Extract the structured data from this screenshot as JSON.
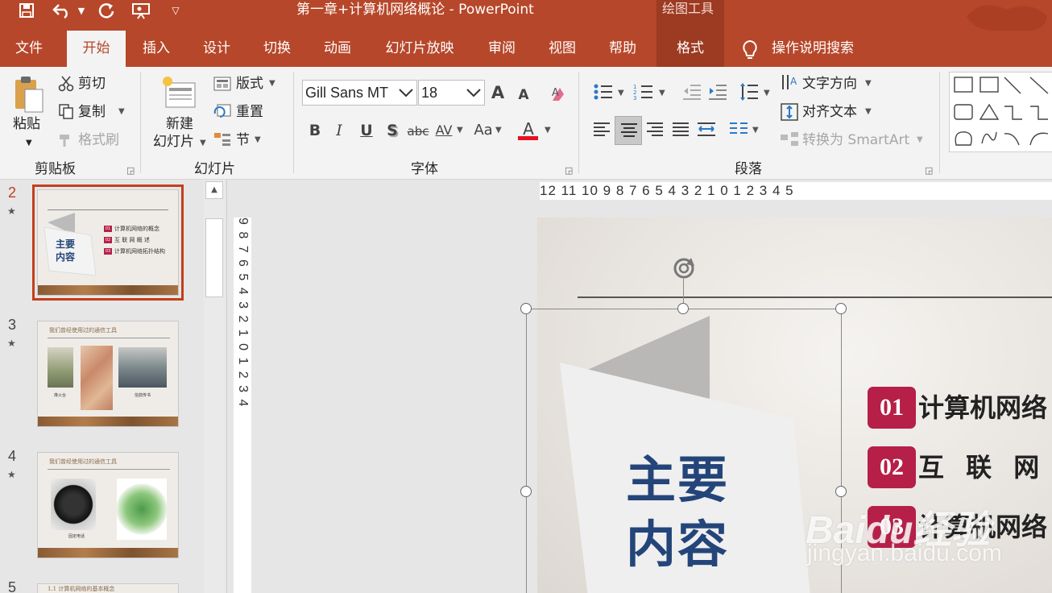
{
  "window": {
    "title": "第一章+计算机网络概论  -  PowerPoint",
    "context_tool_tab": "绘图工具"
  },
  "qat": {
    "icons": [
      "save-icon",
      "undo-icon",
      "undo-dropdown-icon",
      "redo-icon",
      "slideshow-from-start-icon",
      "customize-qat-icon"
    ]
  },
  "tabs": [
    "文件",
    "开始",
    "插入",
    "设计",
    "切换",
    "动画",
    "幻灯片放映",
    "审阅",
    "视图",
    "帮助",
    "格式"
  ],
  "active_tab": "开始",
  "tell_me": "操作说明搜索",
  "clipboard": {
    "paste": "粘贴",
    "cut": "剪切",
    "copy": "复制",
    "format_painter": "格式刷",
    "label": "剪贴板"
  },
  "slides_group": {
    "new_slide_line1": "新建",
    "new_slide_line2": "幻灯片",
    "layout": "版式",
    "reset": "重置",
    "section": "节",
    "label": "幻灯片"
  },
  "font": {
    "name": "Gill Sans MT",
    "size": "18",
    "increase": "A",
    "decrease": "A",
    "bold": "B",
    "italic": "I",
    "underline": "U",
    "shadow": "S",
    "strike": "abc",
    "spacing": "AV",
    "case": "Aa",
    "color_letter": "A",
    "color": "#e81123",
    "label": "字体"
  },
  "paragraph": {
    "label": "段落"
  },
  "text_tools": {
    "direction": "文字方向",
    "align_text": "对齐文本",
    "smartart": "转换为 SmartArt"
  },
  "ruler": {
    "horizontal": "12 11 10 9 8 7 6 5 4 3 2 1 0 1 2 3 4 5",
    "vertical": "9 8 7 6 5 4 3 2 1 0 1 2 3 4"
  },
  "thumbnails": [
    {
      "num": "2",
      "title_line1": "主要",
      "title_line2": "内容",
      "items": [
        "计算机网络的概念",
        "互 联 网 概 述",
        "计算机网络拓扑结构"
      ],
      "badges": [
        "01",
        "02",
        "03"
      ]
    },
    {
      "num": "3",
      "heading": "我们曾经使用过的通信工具",
      "captions": [
        "烽火台",
        "信鸽传书"
      ]
    },
    {
      "num": "4",
      "heading": "我们曾经使用过的通信工具",
      "captions": [
        "固定电话"
      ]
    },
    {
      "num": "5",
      "heading": "1.1 计算机网络的基本概念"
    }
  ],
  "slide": {
    "title_line1": "主要",
    "title_line2": "内容",
    "badges": [
      "01",
      "02",
      "03"
    ],
    "items": [
      "计算机网络",
      "互 联 网 概",
      "计算机网络"
    ]
  },
  "watermark": {
    "logo": "Baidu经验",
    "url": "jingyan.baidu.com"
  },
  "colors": {
    "accent": "#b7472a",
    "badge": "#b61f47",
    "title_blue": "#24457a"
  }
}
